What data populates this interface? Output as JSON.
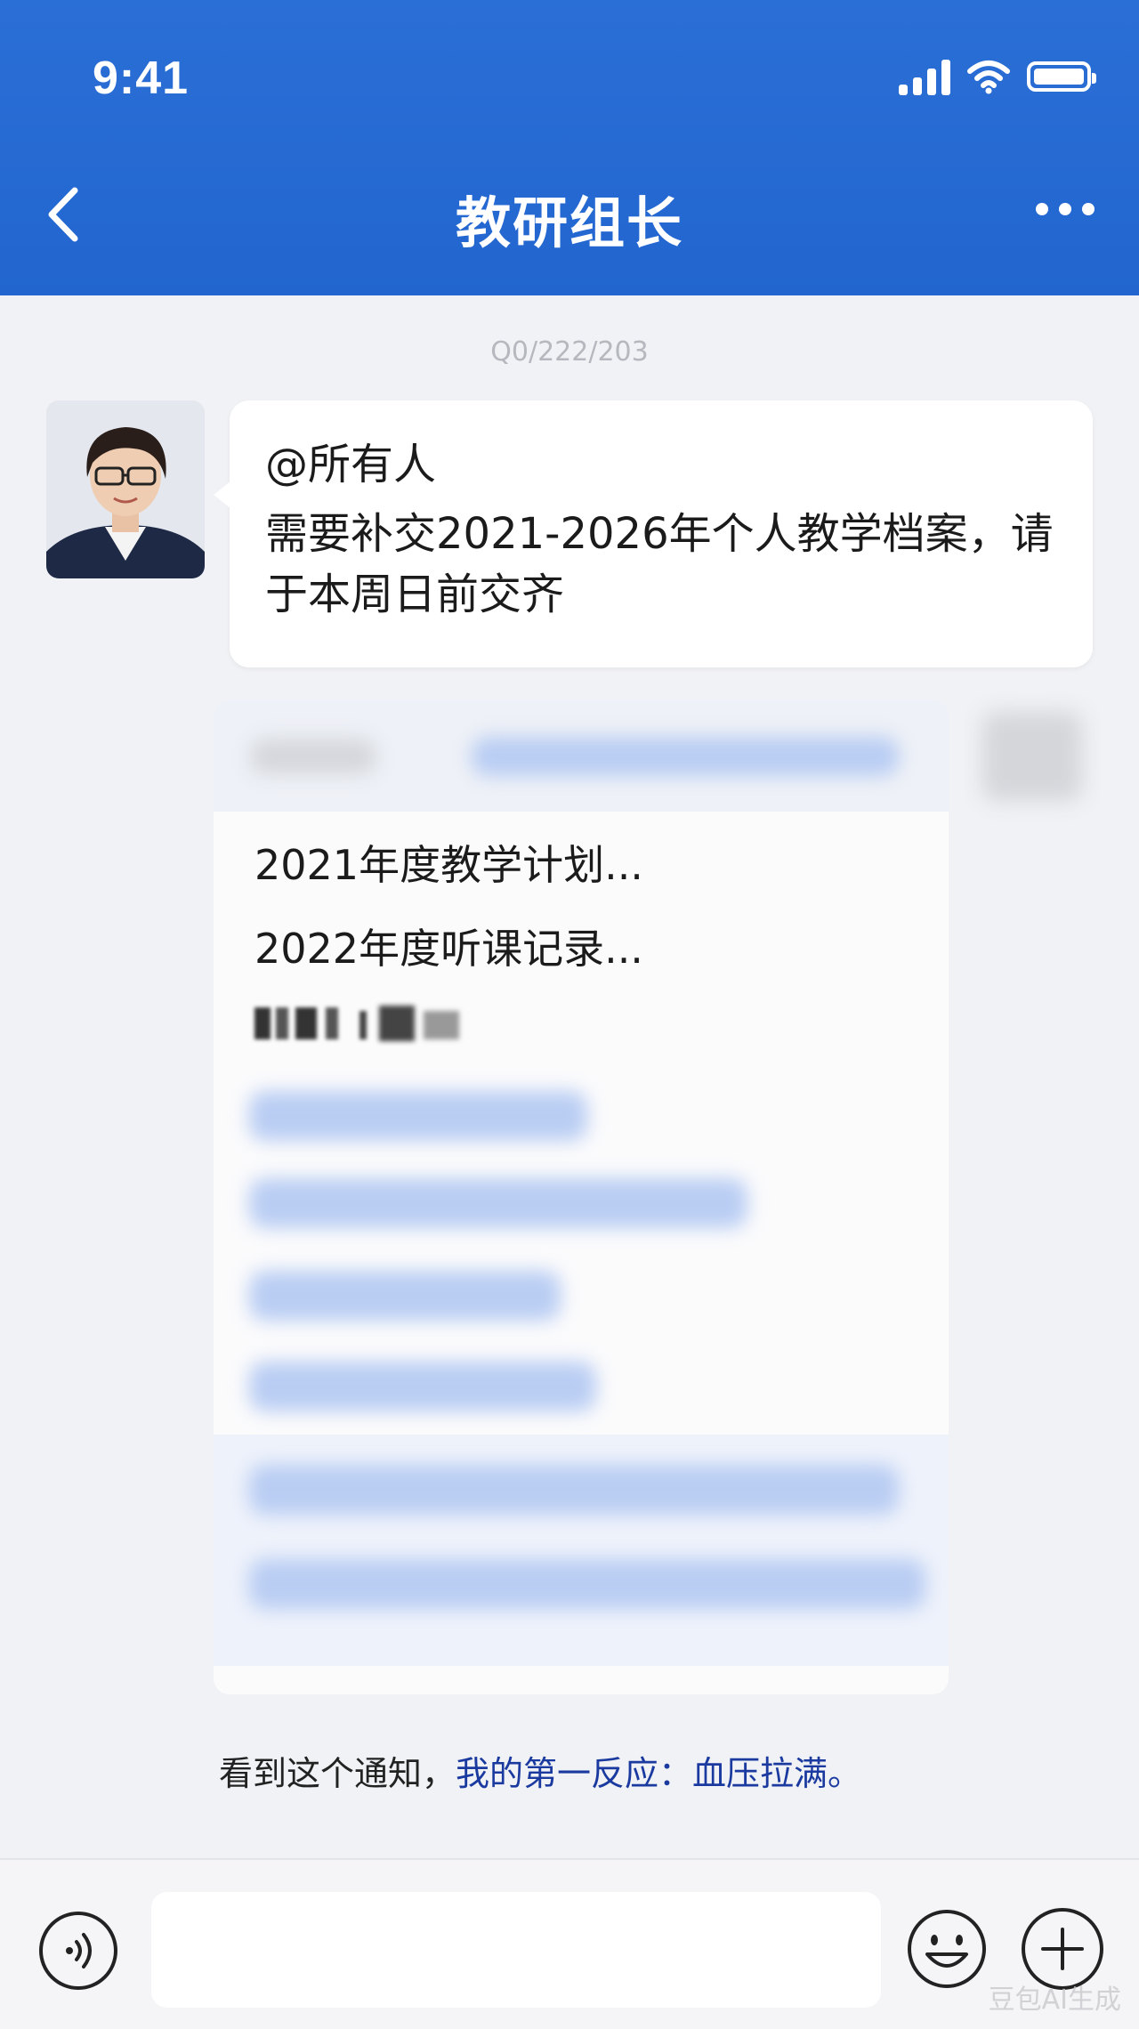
{
  "status_bar": {
    "time": "9:41"
  },
  "nav": {
    "title": "教研组长"
  },
  "chat": {
    "timestamp": "Q0/222/203",
    "message": {
      "mention": "@所有人",
      "text": "需要补交2021-2026年个人教学档案，请于本周日前交齐"
    },
    "document": {
      "lines": [
        "2021年度教学计划...",
        "2022年度听课记录..."
      ]
    },
    "reaction": {
      "prefix": "看到这个通知，",
      "highlight": "我的第一反应：血压拉满。"
    }
  },
  "input": {
    "placeholder": ""
  },
  "watermark": "豆包AI生成",
  "colors": {
    "header": "#2265cf",
    "highlight_text": "#1b3aa0",
    "background": "#f1f2f5"
  }
}
